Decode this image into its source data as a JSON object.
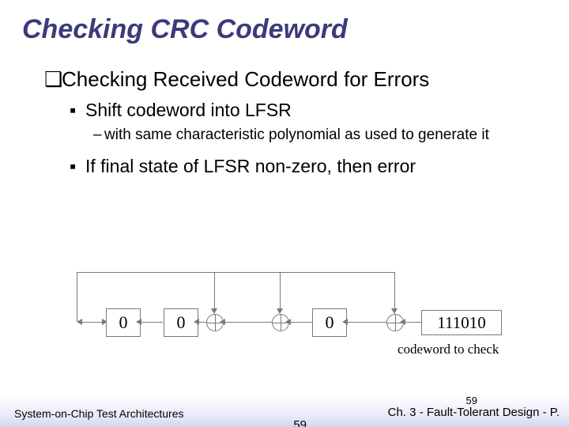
{
  "title": "Checking CRC Codeword",
  "bullets": {
    "l1": "Checking Received Codeword for Errors",
    "l2a": "Shift codeword into LFSR",
    "l3a": "with same characteristic polynomial as used to generate it",
    "l2b": "If final state of LFSR non-zero, then error"
  },
  "diagram": {
    "reg0": "0",
    "reg1": "0",
    "reg2": "0",
    "codeword": "111010",
    "label": "codeword to check"
  },
  "footer": {
    "left": "System-on-Chip Test Architectures",
    "page": "59",
    "right": "Ch. 3 - Fault-Tolerant Design - P.",
    "truncated": "59"
  }
}
